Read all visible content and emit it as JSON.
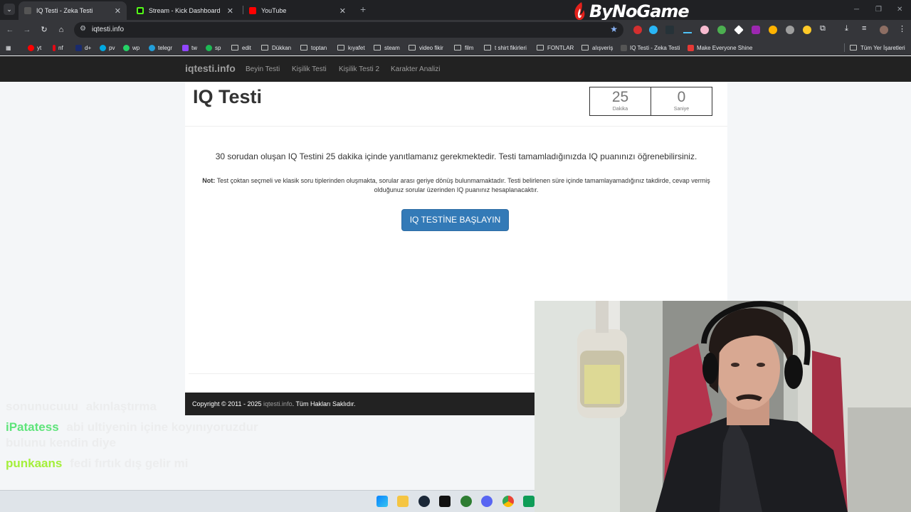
{
  "browser": {
    "tabs": [
      {
        "title": "IQ Testi - Zeka Testi",
        "active": true,
        "favicon_color": "#555555"
      },
      {
        "title": "Stream - Kick Dashboard",
        "active": false,
        "favicon_color": "#53fc18"
      },
      {
        "title": "YouTube",
        "active": false,
        "favicon_color": "#ff0000"
      }
    ],
    "url": "iqtesti.info",
    "bookmarks": [
      {
        "label": "yt",
        "type": "site",
        "color": "#ff0000"
      },
      {
        "label": "nf",
        "type": "site",
        "color": "#e50914"
      },
      {
        "label": "d+",
        "type": "site",
        "color": "#1a2b6d"
      },
      {
        "label": "pv",
        "type": "site",
        "color": "#00a8e1"
      },
      {
        "label": "wp",
        "type": "site",
        "color": "#25d366"
      },
      {
        "label": "telegr",
        "type": "site",
        "color": "#229ed9"
      },
      {
        "label": "tw",
        "type": "site",
        "color": "#9146ff"
      },
      {
        "label": "sp",
        "type": "site",
        "color": "#1db954"
      },
      {
        "label": "edit",
        "type": "folder"
      },
      {
        "label": "Dükkan",
        "type": "folder"
      },
      {
        "label": "toptan",
        "type": "folder"
      },
      {
        "label": "kıyafet",
        "type": "folder"
      },
      {
        "label": "steam",
        "type": "folder"
      },
      {
        "label": "video fikir",
        "type": "folder"
      },
      {
        "label": "film",
        "type": "folder"
      },
      {
        "label": "t shirt fikirleri",
        "type": "folder"
      },
      {
        "label": "FONTLAR",
        "type": "folder"
      },
      {
        "label": "alışveriş",
        "type": "folder"
      },
      {
        "label": "IQ Testi - Zeka Testi",
        "type": "site",
        "color": "#555555"
      },
      {
        "label": "Make Everyone Shine",
        "type": "site",
        "color": "#e53935"
      }
    ],
    "all_bookmarks_label": "Tüm Yer İşaretleri"
  },
  "overlay": {
    "logo_text": "ByNoGame"
  },
  "site": {
    "brand": "iqtesti.info",
    "nav": [
      "Beyin Testi",
      "Kişilik Testi",
      "Kişilik Testi 2",
      "Karakter Analizi"
    ],
    "page_title": "IQ Testi",
    "timer": {
      "minutes": "25",
      "minutes_label": "Dakika",
      "seconds": "0",
      "seconds_label": "Saniye"
    },
    "intro": "30 sorudan oluşan IQ Testini 25 dakika içinde yanıtlamanız gerekmektedir. Testi tamamladığınızda IQ puanınızı öğrenebilirsiniz.",
    "note_label": "Not:",
    "note_text": "Test çoktan seçmeli ve klasik soru tiplerinden oluşmakta, sorular arası geriye dönüş bulunmamaktadır. Testi belirlenen süre içinde tamamlayamadığınız takdirde, cevap vermiş olduğunuz sorular üzerinden IQ puanınız hesaplanacaktır.",
    "start_button": "IQ TESTİNE BAŞLAYIN",
    "footer": {
      "prefix": "Copyright © 2011 - 2025",
      "link": "iqtesti.info",
      "suffix": "Tüm Hakları Saklıdır."
    }
  },
  "chat": [
    {
      "user": "sonunucuuu",
      "user_color": "rgba(230,230,230,0.55)",
      "message": "akınlaştırma"
    },
    {
      "user": "iPatatess",
      "user_color": "#5ee47a",
      "message": "abi ultiyenin içine koyınıyoruzdur",
      "message_line2": "bulunu kendin diye"
    },
    {
      "user": "punkaans",
      "user_color": "#a4ef3a",
      "message": "fedi fırtık dış gelir mi"
    }
  ]
}
